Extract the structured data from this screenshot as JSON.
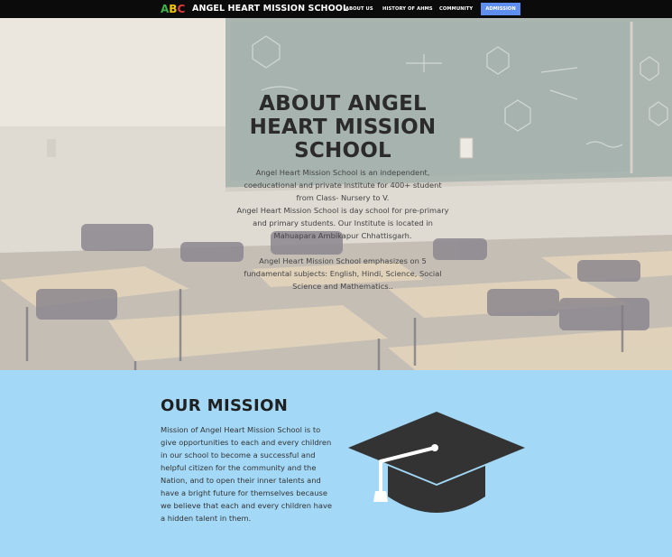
{
  "header": {
    "logo_letters": [
      "A",
      "B",
      "C"
    ],
    "brand": "ANGEL HEART MISSION SCHOOL",
    "nav": {
      "about": "ABOUT US",
      "history": "HISTORY OF AHMS",
      "community": "COMMUNITY",
      "admission": "ADMISSION"
    }
  },
  "hero": {
    "title": "ABOUT ANGEL HEART MISSION SCHOOL",
    "para1": "Angel Heart Mission School is an independent, coeducational and private institute for 400+ student from Class- Nursery to V.",
    "para2": "Angel Heart Mission School is day school for pre-primary and primary students. Our Institute is located in Mahuapara Ambikapur Chhattisgarh.",
    "para3": "Angel Heart Mission School emphasizes on 5 fundamental subjects: English, Hindi, Science, Social Science and Mathematics.."
  },
  "mission": {
    "title": "OUR MISSION",
    "text": "Mission of Angel Heart Mission School is to give opportunities to each and every children in our school to become a successful and helpful citizen for the community and the Nation, and to open their inner talents and have a bright future for themselves because we believe that each and every children have a hidden talent in them."
  },
  "colors": {
    "nav_bg": "#0b0b0b",
    "admission_bg": "#5e8ef0",
    "mission_bg": "#a3d8f6",
    "cap": "#333333",
    "tassel": "#ffffff"
  },
  "icons": {
    "logo": "abc-logo",
    "mission_image": "graduation-cap-icon"
  }
}
